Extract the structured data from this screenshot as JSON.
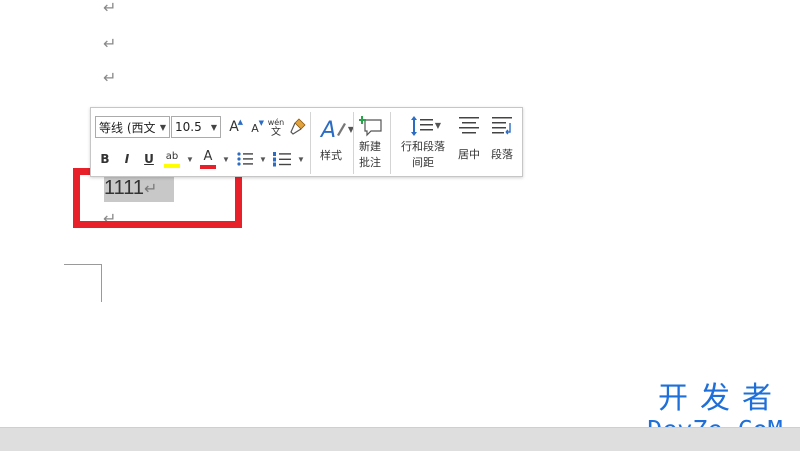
{
  "document": {
    "paragraph_mark": "↵",
    "selected_text": "1111"
  },
  "mini_toolbar": {
    "font_name": "等线 (西文",
    "font_size": "10.5",
    "grow_font_label": "A",
    "shrink_font_label": "A",
    "phonetic_top": "wén",
    "phonetic_bottom": "文",
    "bold_label": "B",
    "italic_label": "I",
    "underline_label": "U",
    "highlight_label": "ab",
    "font_color_label": "A",
    "styles_label": "样式",
    "new_comment_line1": "新建",
    "new_comment_line2": "批注",
    "line_spacing_line1": "行和段落",
    "line_spacing_line2": "间距",
    "center_label": "居中",
    "paragraph_label": "段落"
  },
  "watermark": {
    "top": "开发者",
    "bottom": "DevZe.CoM"
  },
  "colors": {
    "highlight": "#ffff00",
    "font_color": "#e8202a",
    "annotation_frame": "#e8202a",
    "watermark": "#1e6fd9",
    "accent_blue": "#2b6cc4"
  }
}
